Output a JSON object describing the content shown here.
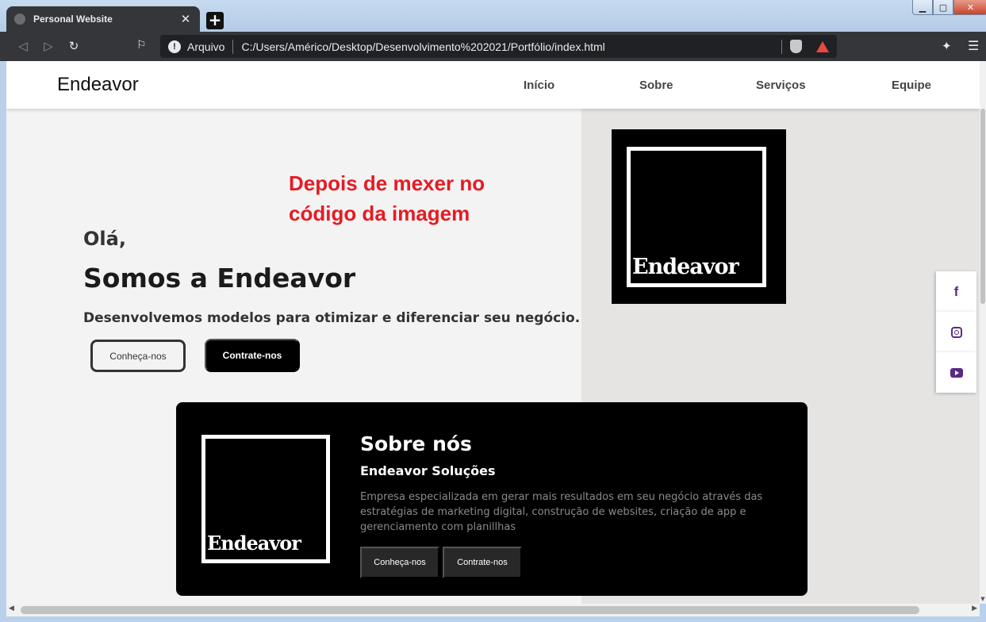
{
  "browser": {
    "tab_title": "Personal Website",
    "tab_close": "✕",
    "new_tab": "+",
    "address_scheme": "Arquivo",
    "address_url": "C:/Users/Américo/Desktop/Desenvolvimento%202021/Portfólio/index.html",
    "icons": [
      "back-icon",
      "forward-icon",
      "reload-icon",
      "bookmark-icon",
      "info-icon",
      "brave-shield-icon",
      "bat-icon",
      "extensions-icon",
      "menu-icon"
    ]
  },
  "site": {
    "brand": "Endeavor",
    "nav": [
      "Início",
      "Sobre",
      "Serviços",
      "Equipe"
    ],
    "annotation_line1": "Depois de mexer no",
    "annotation_line2": "código da imagem",
    "hero": {
      "greeting": "Olá,",
      "headline": "Somos a Endeavor",
      "tagline": "Desenvolvemos modelos para otimizar e diferenciar seu negócio.",
      "btn_primary": "Conheça-nos",
      "btn_secondary": "Contrate-nos"
    },
    "logo_text": "Endeavor",
    "social": [
      "f",
      "instagram",
      "youtube"
    ],
    "about": {
      "title": "Sobre nós",
      "subtitle": "Endeavor Soluções",
      "description": "Empresa especializada em gerar mais resultados em seu negócio através das estratégias de marketing digital, construção de websites, criação de app e gerenciamento com planillhas",
      "btn1": "Conheça-nos",
      "btn2": "Contrate-nos"
    },
    "colors": {
      "accent_annotation": "#e51b24",
      "social_icon": "#5a2a86",
      "dark": "#000000"
    }
  }
}
